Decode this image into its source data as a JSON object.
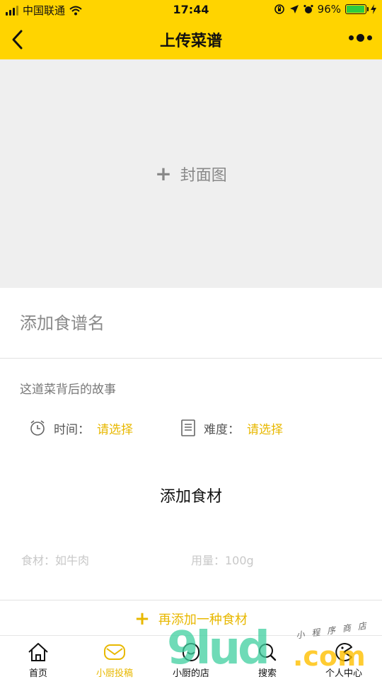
{
  "status_bar": {
    "carrier": "中国联通",
    "time": "17:44",
    "battery": "96%"
  },
  "nav": {
    "title": "上传菜谱"
  },
  "cover": {
    "label": "封面图"
  },
  "form": {
    "title_placeholder": "添加食谱名",
    "story_placeholder": "这道菜背后的故事",
    "time_label": "时间：",
    "time_value": "请选择",
    "difficulty_label": "难度：",
    "difficulty_value": "请选择",
    "ingredients_title": "添加食材",
    "ingredient_placeholder": "食材：如牛肉",
    "amount_placeholder": "用量：100g",
    "add_more": "再添加一种食材"
  },
  "tabs": [
    {
      "label": "首页"
    },
    {
      "label": "小厨投稿"
    },
    {
      "label": "小厨的店"
    },
    {
      "label": "搜索"
    },
    {
      "label": "个人中心"
    }
  ],
  "watermark": {
    "big": "9lud",
    "domain": ".com",
    "small": "小程序商店"
  },
  "colors": {
    "brand_yellow": "#FFD400",
    "accent": "#E8B800"
  }
}
